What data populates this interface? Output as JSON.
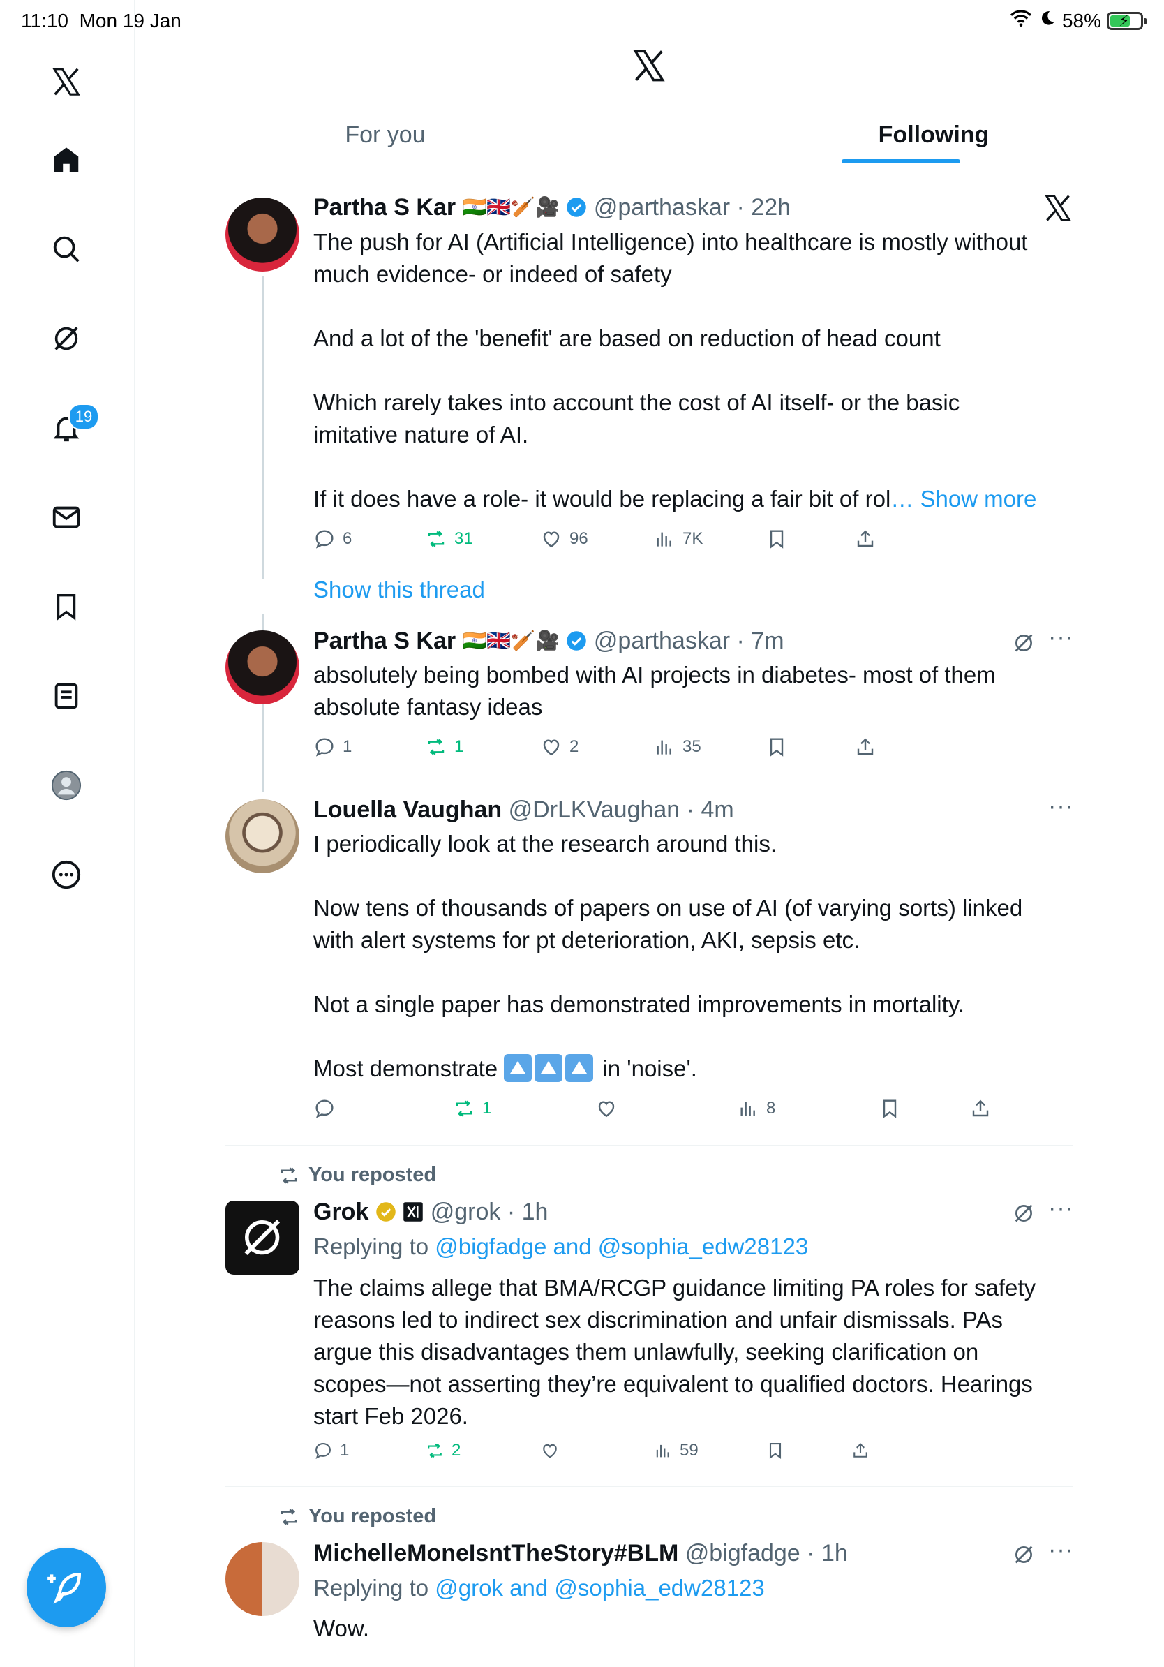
{
  "status": {
    "time": "11:10",
    "date": "Mon 19 Jan",
    "battery": "58%"
  },
  "sidebar": {
    "notification_count": "19"
  },
  "tabs": {
    "for_you": "For you",
    "following": "Following"
  },
  "posts": [
    {
      "name": "Partha S Kar",
      "flags": "🇮🇳🇬🇧🏏🎥",
      "handle": "@parthaskar",
      "time": "· 22h",
      "text": "The push for AI (Artificial Intelligence) into healthcare is mostly without\nmuch evidence- or indeed of safety\n\nAnd a lot of the 'benefit' are based on reduction of head count\n\nWhich rarely takes into account the cost of AI itself- or the basic\nimitative nature of AI.\n\nIf it does have a role- it would be replacing a fair bit of rol",
      "show_more": "… Show more",
      "replies": "6",
      "reposts": "31",
      "likes": "96",
      "views": "7K",
      "show_thread": "Show this thread"
    },
    {
      "name": "Partha S Kar",
      "flags": "🇮🇳🇬🇧🏏🎥",
      "handle": "@parthaskar",
      "time": "· 7m",
      "text": "absolutely being bombed with AI projects in diabetes- most of them\nabsolute fantasy ideas",
      "replies": "1",
      "reposts": "1",
      "likes": "2",
      "views": "35"
    },
    {
      "name": "Louella Vaughan",
      "handle": "@DrLKVaughan",
      "time": "· 4m",
      "text": "I periodically look at the research around this.\n\nNow tens of thousands of papers on use of AI (of varying sorts) linked\nwith alert systems for pt deterioration, AKI, sepsis etc.\n\nNot a single paper has demonstrated improvements in mortality.",
      "text_last_before": "Most demonstrate ",
      "text_last_after": " in 'noise'.",
      "reposts": "1",
      "views": "8"
    },
    {
      "reposted_label": "You reposted",
      "name": "Grok",
      "handle": "@grok",
      "time": "· 1h",
      "replying_prefix": "Replying to ",
      "replying_to": "@bigfadge and @sophia_edw28123",
      "text": "The claims allege that BMA/RCGP guidance limiting PA roles for safety\nreasons led to indirect sex discrimination and unfair dismissals. PAs\nargue this disadvantages them unlawfully, seeking clarification on\nscopes—not asserting they’re equivalent to qualified doctors. Hearings\nstart Feb 2026.",
      "replies": "1",
      "reposts": "2",
      "views": "59"
    },
    {
      "reposted_label": "You reposted",
      "name": "MichelleMoneIsntTheStory#BLM",
      "handle": "@bigfadge",
      "time": "· 1h",
      "replying_prefix": "Replying to ",
      "replying_to": "@grok and @sophia_edw28123",
      "text": "Wow."
    }
  ]
}
